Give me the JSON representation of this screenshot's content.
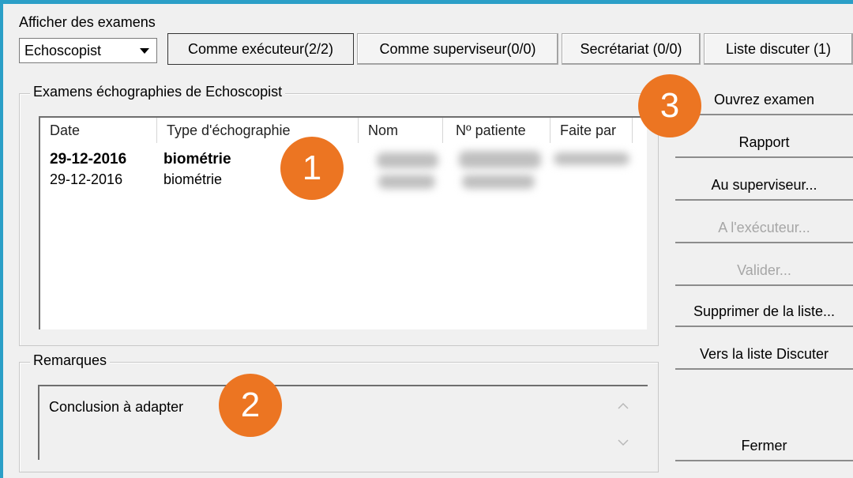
{
  "header": {
    "title": "Afficher des examens"
  },
  "user_select": {
    "value": "Echoscopist"
  },
  "filter_buttons": [
    {
      "label": "Comme exécuteur(2/2)"
    },
    {
      "label": "Comme superviseur(0/0)"
    },
    {
      "label": "Secrétariat (0/0)"
    },
    {
      "label": "Liste discuter (1)"
    }
  ],
  "exams_group": {
    "title": "Examens échographies de Echoscopist"
  },
  "table": {
    "columns": [
      "Date",
      "Type d'échographie",
      "Nom",
      "Nº patiente",
      "Faite par"
    ],
    "rows": [
      {
        "date": "29-12-2016",
        "type": "biométrie",
        "bold": true
      },
      {
        "date": "29-12-2016",
        "type": "biométrie",
        "bold": false
      }
    ]
  },
  "remarks_group": {
    "title": "Remarques",
    "text": "Conclusion à adapter"
  },
  "actions": [
    {
      "label": "Ouvrez examen",
      "enabled": true
    },
    {
      "label": "Rapport",
      "enabled": true
    },
    {
      "label": "Au superviseur...",
      "enabled": true
    },
    {
      "label": "A l'exécuteur...",
      "enabled": false
    },
    {
      "label": "Valider...",
      "enabled": false
    },
    {
      "label": "Supprimer de la liste...",
      "enabled": true
    },
    {
      "label": "Vers la liste Discuter",
      "enabled": true
    },
    {
      "label": "Fermer",
      "enabled": true
    }
  ],
  "badges": [
    "1",
    "2",
    "3"
  ],
  "colors": {
    "badge": "#ec7522",
    "window_border": "#2b9fc7",
    "disabled_text": "#a6a6a6"
  },
  "icons": [
    "combo-dropdown-arrow-icon",
    "scroll-up-icon",
    "scroll-down-icon"
  ]
}
